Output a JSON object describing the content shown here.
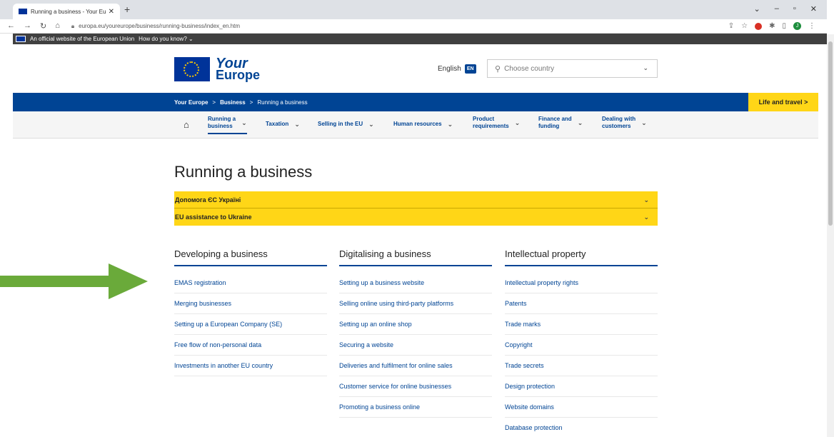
{
  "browser": {
    "tab_title": "Running a business - Your Europ",
    "tab_close": "✕",
    "new_tab": "+",
    "url": "europa.eu/youreurope/business/running-business/index_en.htm",
    "window_controls": [
      "⌄",
      "–",
      "▫",
      "✕"
    ]
  },
  "eu_banner": {
    "text": "An official website of the European Union",
    "how_know": "How do you know? ⌄"
  },
  "header": {
    "logo_your": "Your",
    "logo_europe": "Europe",
    "language": "English",
    "language_code": "EN",
    "country_placeholder": "Choose country"
  },
  "breadcrumb": {
    "items": [
      "Your Europe",
      "Business",
      "Running a business"
    ],
    "separator": ">",
    "life_travel": "Life and travel  >"
  },
  "mainnav": {
    "items": [
      {
        "line1": "Running a",
        "line2": "business"
      },
      {
        "line1": "Taxation",
        "line2": ""
      },
      {
        "line1": "Selling in the EU",
        "line2": ""
      },
      {
        "line1": "Human resources",
        "line2": ""
      },
      {
        "line1": "Product",
        "line2": "requirements"
      },
      {
        "line1": "Finance and",
        "line2": "funding"
      },
      {
        "line1": "Dealing with",
        "line2": "customers"
      }
    ]
  },
  "main": {
    "title": "Running a business",
    "accordions": [
      "Допомога ЄС Україні",
      "EU assistance to Ukraine"
    ],
    "columns": [
      {
        "heading": "Developing a business",
        "links": [
          "EMAS registration",
          "Merging businesses",
          "Setting up a European Company (SE)",
          "Free flow of non-personal data",
          "Investments in another EU country"
        ]
      },
      {
        "heading": "Digitalising a business",
        "links": [
          "Setting up a business website",
          "Selling online using third-party platforms",
          "Setting up an online shop",
          "Securing a website",
          "Deliveries and fulfilment for online sales",
          "Customer service for online businesses",
          "Promoting a business online"
        ]
      },
      {
        "heading": "Intellectual property",
        "links": [
          "Intellectual property rights",
          "Patents",
          "Trade marks",
          "Copyright",
          "Trade secrets",
          "Design protection",
          "Website domains",
          "Database protection"
        ]
      }
    ]
  },
  "colors": {
    "eu_blue": "#004494",
    "yellow": "#ffd617",
    "arrow_green": "#6aaa3a"
  }
}
